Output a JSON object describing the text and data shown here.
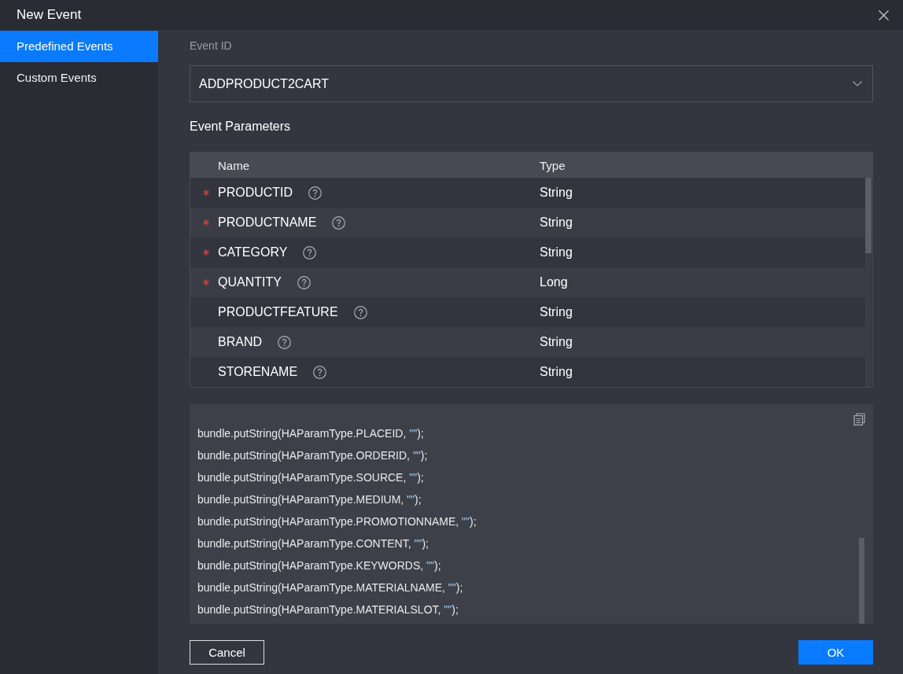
{
  "window": {
    "title": "New Event"
  },
  "sidebar": {
    "items": [
      {
        "label": "Predefined Events",
        "selected": true
      },
      {
        "label": "Custom Events",
        "selected": false
      }
    ]
  },
  "event_id": {
    "label": "Event ID",
    "value": "ADDPRODUCT2CART"
  },
  "parameters": {
    "title": "Event Parameters",
    "columns": [
      "Name",
      "Type"
    ],
    "rows": [
      {
        "name": "PRODUCTID",
        "type": "String",
        "required": true
      },
      {
        "name": "PRODUCTNAME",
        "type": "String",
        "required": true
      },
      {
        "name": "CATEGORY",
        "type": "String",
        "required": true
      },
      {
        "name": "QUANTITY",
        "type": "Long",
        "required": true
      },
      {
        "name": "PRODUCTFEATURE",
        "type": "String",
        "required": false
      },
      {
        "name": "BRAND",
        "type": "String",
        "required": false
      },
      {
        "name": "STORENAME",
        "type": "String",
        "required": false
      }
    ]
  },
  "code": {
    "lines": [
      {
        "call": "bundle.putString(HAParamType.PLACEID, ",
        "literal": "\"\"",
        "end": ");"
      },
      {
        "call": "bundle.putString(HAParamType.ORDERID, ",
        "literal": "\"\"",
        "end": ");"
      },
      {
        "call": "bundle.putString(HAParamType.SOURCE, ",
        "literal": "\"\"",
        "end": ");"
      },
      {
        "call": "bundle.putString(HAParamType.MEDIUM, ",
        "literal": "\"\"",
        "end": ");"
      },
      {
        "call": "bundle.putString(HAParamType.PROMOTIONNAME, ",
        "literal": "\"\"",
        "end": ");"
      },
      {
        "call": "bundle.putString(HAParamType.CONTENT, ",
        "literal": "\"\"",
        "end": ");"
      },
      {
        "call": "bundle.putString(HAParamType.KEYWORDS, ",
        "literal": "\"\"",
        "end": ");"
      },
      {
        "call": "bundle.putString(HAParamType.MATERIALNAME, ",
        "literal": "\"\"",
        "end": ");"
      },
      {
        "call": "bundle.putString(HAParamType.MATERIALSLOT, ",
        "literal": "\"\"",
        "end": ");"
      }
    ]
  },
  "buttons": [
    {
      "label": "Cancel",
      "kind": "secondary"
    },
    {
      "label": "OK",
      "kind": "primary"
    }
  ]
}
